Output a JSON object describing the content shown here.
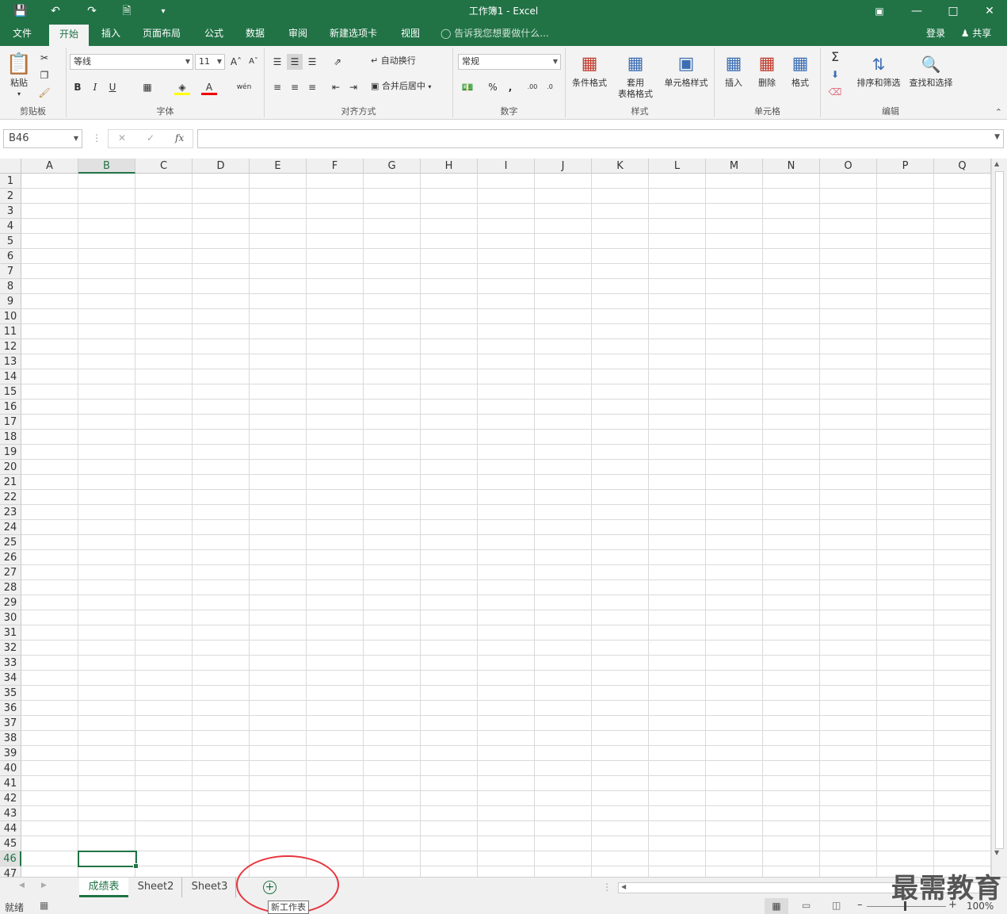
{
  "title_bar": {
    "title": "工作簿1 - Excel",
    "save_icon": "save-icon",
    "undo_icon": "undo-icon",
    "redo_icon": "redo-icon",
    "new_icon": "new-file-icon"
  },
  "menu_tabs": [
    "文件",
    "开始",
    "插入",
    "页面布局",
    "公式",
    "数据",
    "审阅",
    "新建选项卡",
    "视图"
  ],
  "tell_me": "告诉我您想要做什么...",
  "login": "登录",
  "share": "共享",
  "ribbon": {
    "clipboard": {
      "label": "剪贴板",
      "paste": "粘贴"
    },
    "font": {
      "label": "字体",
      "name": "等线",
      "size": "11"
    },
    "alignment": {
      "label": "对齐方式",
      "wrap": "自动换行",
      "merge": "合并后居中"
    },
    "number": {
      "label": "数字",
      "format": "常规"
    },
    "styles": {
      "label": "样式",
      "conditional": "条件格式",
      "table_1": "套用",
      "table_2": "表格格式",
      "cell_style": "单元格样式"
    },
    "cells": {
      "label": "单元格",
      "insert": "插入",
      "delete": "删除",
      "format": "格式"
    },
    "editing": {
      "label": "编辑",
      "sort": "排序和筛选",
      "find": "查找和选择"
    }
  },
  "name_box": "B46",
  "columns": [
    "A",
    "B",
    "C",
    "D",
    "E",
    "F",
    "G",
    "H",
    "I",
    "J",
    "K",
    "L",
    "M",
    "N",
    "O",
    "P",
    "Q"
  ],
  "rows": [
    "1",
    "2",
    "3",
    "4",
    "5",
    "6",
    "7",
    "8",
    "9",
    "10",
    "11",
    "12",
    "13",
    "14",
    "15",
    "16",
    "17",
    "18",
    "19",
    "20",
    "21",
    "22",
    "23",
    "24",
    "25",
    "26",
    "27",
    "28",
    "29",
    "30",
    "31",
    "32",
    "33",
    "34",
    "35",
    "36",
    "37",
    "38",
    "39",
    "40",
    "41",
    "42",
    "43",
    "44",
    "45",
    "46",
    "47"
  ],
  "selected_col": "B",
  "selected_row": "46",
  "sheets": [
    "成绩表",
    "Sheet2",
    "Sheet3"
  ],
  "new_sheet_tooltip": "新工作表",
  "status": {
    "ready": "就绪",
    "zoom": "100%"
  },
  "watermark": "最需教育"
}
